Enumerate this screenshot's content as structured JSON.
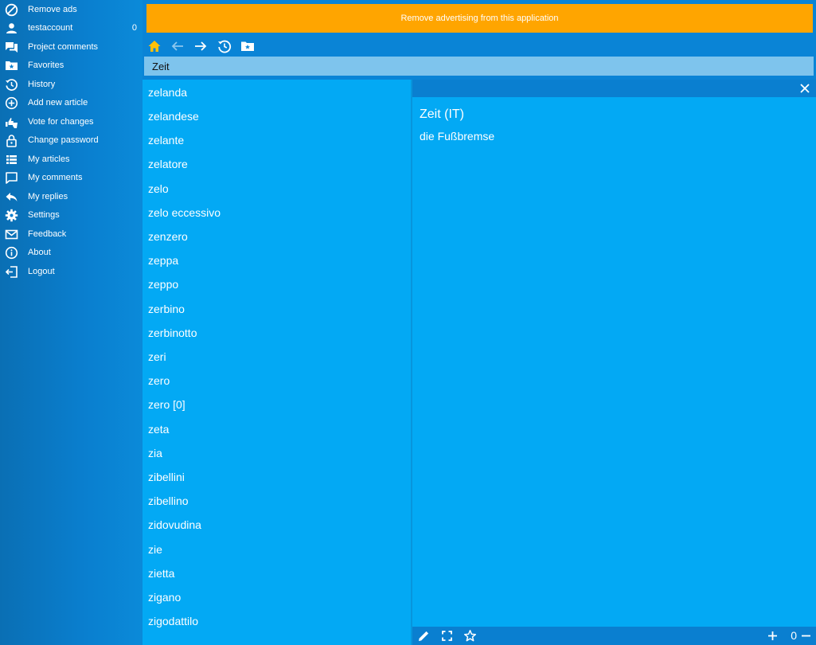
{
  "sidebar": {
    "items": [
      {
        "label": "Remove ads",
        "icon": "block-icon"
      },
      {
        "label": "testaccount",
        "icon": "user-icon",
        "count": "0"
      },
      {
        "label": "Project comments",
        "icon": "comments-icon"
      },
      {
        "label": "Favorites",
        "icon": "favorite-folder-icon"
      },
      {
        "label": "History",
        "icon": "history-icon"
      },
      {
        "label": "Add new article",
        "icon": "add-circle-icon"
      },
      {
        "label": "Vote for changes",
        "icon": "vote-icon"
      },
      {
        "label": "Change password",
        "icon": "lock-icon"
      },
      {
        "label": "My articles",
        "icon": "list-icon"
      },
      {
        "label": "My comments",
        "icon": "comment-icon"
      },
      {
        "label": "My replies",
        "icon": "reply-icon"
      },
      {
        "label": "Settings",
        "icon": "gear-icon"
      },
      {
        "label": "Feedback",
        "icon": "mail-icon"
      },
      {
        "label": "About",
        "icon": "info-icon"
      },
      {
        "label": "Logout",
        "icon": "logout-icon"
      }
    ]
  },
  "banner": {
    "text": "Remove advertising from this application",
    "color": "#ffa500"
  },
  "search": {
    "value": "Zeit"
  },
  "word_list": [
    "zelanda",
    "zelandese",
    "zelante",
    "zelatore",
    "zelo",
    "zelo eccessivo",
    "zenzero",
    "zeppa",
    "zeppo",
    "zerbino",
    "zerbinotto",
    "zeri",
    "zero",
    "zero [0]",
    "zeta",
    "zia",
    "zibellini",
    "zibellino",
    "zidovudina",
    "zie",
    "zietta",
    "zigano",
    "zigodattilo"
  ],
  "entry": {
    "title": "Zeit (IT)",
    "translation": "die Fußbremse"
  },
  "bottom_bar": {
    "zoom_value": "0"
  },
  "colors": {
    "accent": "#03a9f4",
    "home_icon": "#ffc107"
  }
}
